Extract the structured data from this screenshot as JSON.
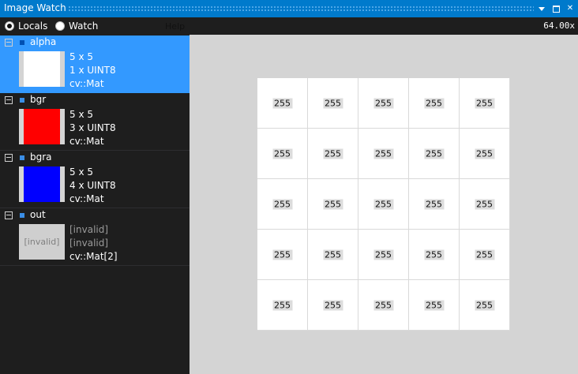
{
  "window": {
    "title": "Image Watch",
    "icons": {
      "pin": "caret-down-icon",
      "maximize": "maximize-icon",
      "close": "close-icon"
    }
  },
  "mode": {
    "locals_label": "Locals",
    "watch_label": "Watch",
    "selected": "Locals",
    "help_label": "Help"
  },
  "zoom": "64.00x",
  "colors": {
    "accent": "#007acc",
    "selection": "#3399ff",
    "bgr_fill": "#ff0000",
    "bgra_fill": "#0000ff",
    "alpha_fill": "#ffffff"
  },
  "variables": [
    {
      "name": "alpha",
      "size": "5 x 5",
      "type": "1 x UINT8",
      "class": "cv::Mat",
      "preview": "#ffffff",
      "selected": true
    },
    {
      "name": "bgr",
      "size": "5 x 5",
      "type": "3 x UINT8",
      "class": "cv::Mat",
      "preview": "#ff0000",
      "selected": false
    },
    {
      "name": "bgra",
      "size": "5 x 5",
      "type": "4 x UINT8",
      "class": "cv::Mat",
      "preview": "#0000ff",
      "selected": false
    },
    {
      "name": "out",
      "size": "[invalid]",
      "type": "[invalid]",
      "class": "cv::Mat[2]",
      "preview_text": "[invalid]",
      "selected": false
    }
  ],
  "pixels": [
    [
      "255",
      "255",
      "255",
      "255",
      "255"
    ],
    [
      "255",
      "255",
      "255",
      "255",
      "255"
    ],
    [
      "255",
      "255",
      "255",
      "255",
      "255"
    ],
    [
      "255",
      "255",
      "255",
      "255",
      "255"
    ],
    [
      "255",
      "255",
      "255",
      "255",
      "255"
    ]
  ]
}
